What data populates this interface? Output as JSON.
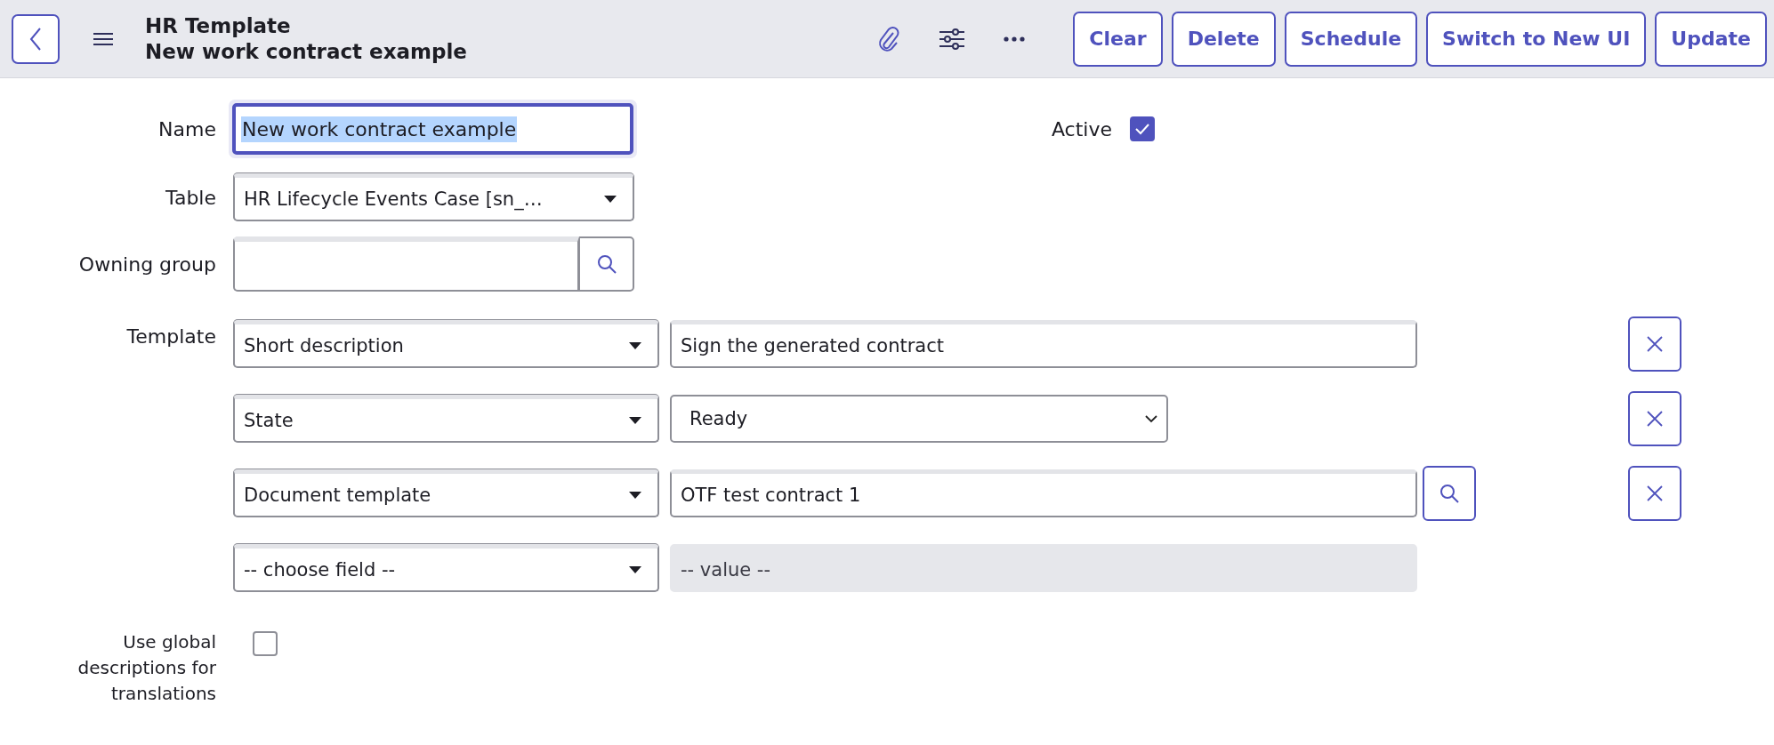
{
  "header": {
    "title": "HR Template",
    "subtitle": "New work contract example",
    "buttons": [
      "Clear",
      "Delete",
      "Schedule",
      "Switch to New UI",
      "Update"
    ]
  },
  "name": {
    "label": "Name",
    "value": "New work contract example",
    "text_selected": true
  },
  "active": {
    "label": "Active",
    "checked": true
  },
  "table": {
    "label": "Table",
    "value": "HR Lifecycle Events Case [sn_…"
  },
  "owning_group": {
    "label": "Owning group"
  },
  "template": {
    "label": "Template",
    "rows": [
      {
        "field": "Short description",
        "kind": "text",
        "value": "Sign the generated contract",
        "removable": true
      },
      {
        "field": "State",
        "kind": "choice",
        "value": "Ready",
        "removable": true
      },
      {
        "field": "Document template",
        "kind": "reference",
        "value": "OTF test contract 1",
        "removable": true
      },
      {
        "field": "-- choose field --",
        "kind": "empty",
        "placeholder": "-- value --",
        "removable": false
      }
    ]
  },
  "use_global": {
    "label": "Use global descriptions for translations",
    "checked": false
  }
}
